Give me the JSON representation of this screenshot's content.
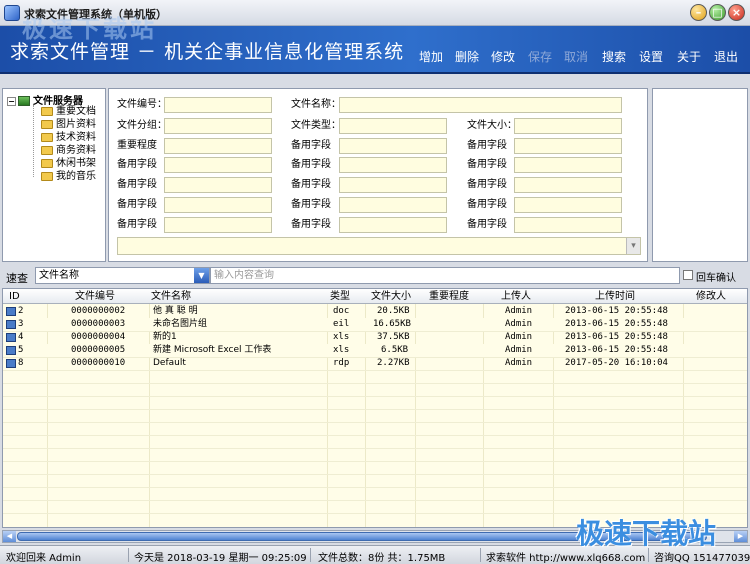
{
  "window": {
    "title": "求索文件管理系统（单机版）"
  },
  "banner": {
    "title": "求索文件管理 － 机关企事业信息化管理系统"
  },
  "toolbar": {
    "items": [
      {
        "label": "增加",
        "enabled": true
      },
      {
        "label": "删除",
        "enabled": true
      },
      {
        "label": "修改",
        "enabled": true
      },
      {
        "label": "保存",
        "enabled": false
      },
      {
        "label": "取消",
        "enabled": false
      },
      {
        "label": "搜索",
        "enabled": true
      },
      {
        "label": "设置",
        "enabled": true
      },
      {
        "label": "关于",
        "enabled": true
      },
      {
        "label": "退出",
        "enabled": true
      }
    ]
  },
  "tree": {
    "root": "文件服务器",
    "expander": "−",
    "items": [
      "重要文档",
      "图片资料",
      "技术资料",
      "商务资料",
      "休闲书架",
      "我的音乐"
    ]
  },
  "form": {
    "file_no": "文件编号：",
    "file_name": "文件名称：",
    "file_group": "文件分组：",
    "file_type": "文件类型：",
    "file_size": "文件大小：",
    "importance": "重要程度",
    "spare": "备用字段"
  },
  "search": {
    "label": "速查",
    "field": "文件名称",
    "placeholder": "输入内容查询",
    "enter_confirm": "回车确认"
  },
  "table": {
    "headers": [
      "ID",
      "文件编号",
      "文件名称",
      "类型",
      "文件大小",
      "重要程度",
      "上传人",
      "上传时间",
      "修改人"
    ],
    "rows": [
      {
        "id": "2",
        "no": "0000000002",
        "name": "他 真 聪 明",
        "type": "doc",
        "size": "20.5KB",
        "importance": "",
        "uploader": "Admin",
        "time": "2013-06-15 20:55:48",
        "modifier": ""
      },
      {
        "id": "3",
        "no": "0000000003",
        "name": "未命名图片组",
        "type": "eil",
        "size": "16.65KB",
        "importance": "",
        "uploader": "Admin",
        "time": "2013-06-15 20:55:48",
        "modifier": ""
      },
      {
        "id": "4",
        "no": "0000000004",
        "name": "新的1",
        "type": "xls",
        "size": "37.5KB",
        "importance": "",
        "uploader": "Admin",
        "time": "2013-06-15 20:55:48",
        "modifier": ""
      },
      {
        "id": "5",
        "no": "0000000005",
        "name": "新建 Microsoft Excel 工作表",
        "type": "xls",
        "size": "6.5KB",
        "importance": "",
        "uploader": "Admin",
        "time": "2013-06-15 20:55:48",
        "modifier": ""
      },
      {
        "id": "8",
        "no": "0000000010",
        "name": "Default",
        "type": "rdp",
        "size": "2.27KB",
        "importance": "",
        "uploader": "Admin",
        "time": "2017-05-20 16:10:04",
        "modifier": ""
      }
    ]
  },
  "status": {
    "welcome": "欢迎回来 Admin",
    "today": "今天是 2018-03-19 星期一 09:25:09",
    "totals": "文件总数：8份  共：1.75MB",
    "vendor": "求索软件  http://www.xlq668.com",
    "contact": "咨询QQ 151477039"
  },
  "watermark": {
    "text": "极速下载站"
  }
}
